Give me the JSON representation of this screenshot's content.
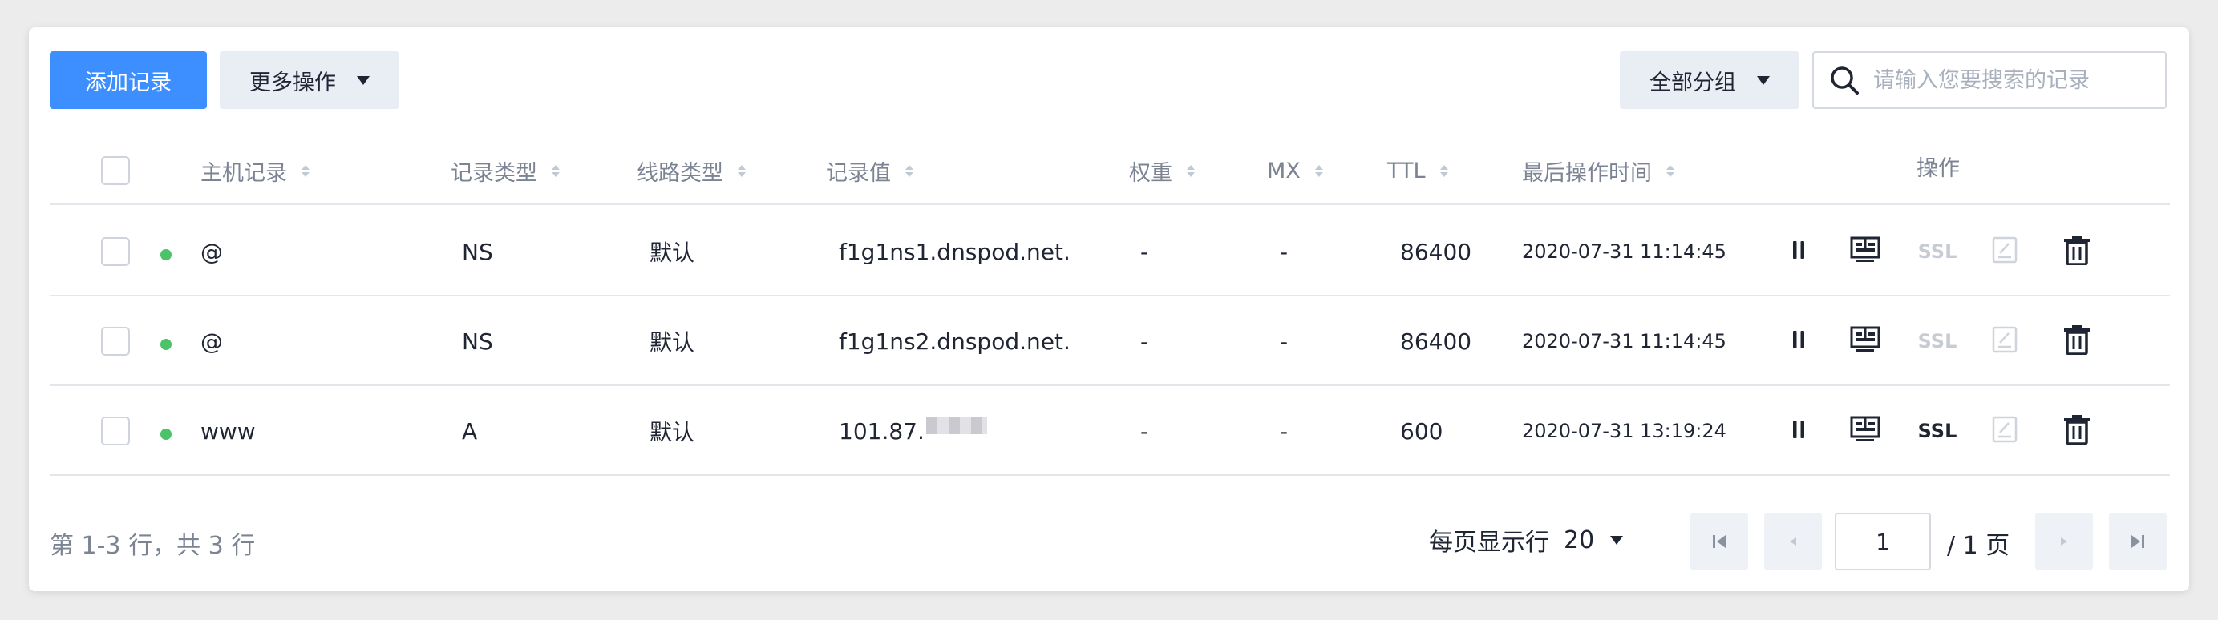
{
  "toolbar": {
    "add_label": "添加记录",
    "more_label": "更多操作",
    "group_label": "全部分组",
    "search_placeholder": "请输入您要搜索的记录"
  },
  "columns": {
    "host": "主机记录",
    "type": "记录类型",
    "line": "线路类型",
    "value": "记录值",
    "weight": "权重",
    "mx": "MX",
    "ttl": "TTL",
    "updated": "最后操作时间",
    "actions": "操作"
  },
  "records": [
    {
      "host": "@",
      "type": "NS",
      "line": "默认",
      "value": "f1g1ns1.dnspod.net.",
      "weight": "-",
      "mx": "-",
      "ttl": "86400",
      "updated": "2020-07-31 11:14:45",
      "ssl": "SSL",
      "status_color": "#4cc26a",
      "ssl_enabled": false
    },
    {
      "host": "@",
      "type": "NS",
      "line": "默认",
      "value": "f1g1ns2.dnspod.net.",
      "weight": "-",
      "mx": "-",
      "ttl": "86400",
      "updated": "2020-07-31 11:14:45",
      "ssl": "SSL",
      "status_color": "#4cc26a",
      "ssl_enabled": false
    },
    {
      "host": "www",
      "type": "A",
      "line": "默认",
      "value": "101.87.",
      "weight": "-",
      "mx": "-",
      "ttl": "600",
      "updated": "2020-07-31 13:19:24",
      "ssl": "SSL",
      "status_color": "#4cc26a",
      "ssl_enabled": true
    }
  ],
  "icons": {
    "pause": "pause-icon",
    "monitor": "monitor-icon",
    "edit": "edit-icon",
    "delete": "trash-icon",
    "search": "search-icon"
  },
  "footer": {
    "range_text": "第 1-3 行，共 3 行",
    "per_page_label": "每页显示行",
    "per_page_value": "20",
    "current_page": "1",
    "total_pages": "/ 1 页"
  },
  "colors": {
    "primary": "#3d8eff",
    "status_on": "#4cc26a",
    "muted": "#7c8494"
  }
}
